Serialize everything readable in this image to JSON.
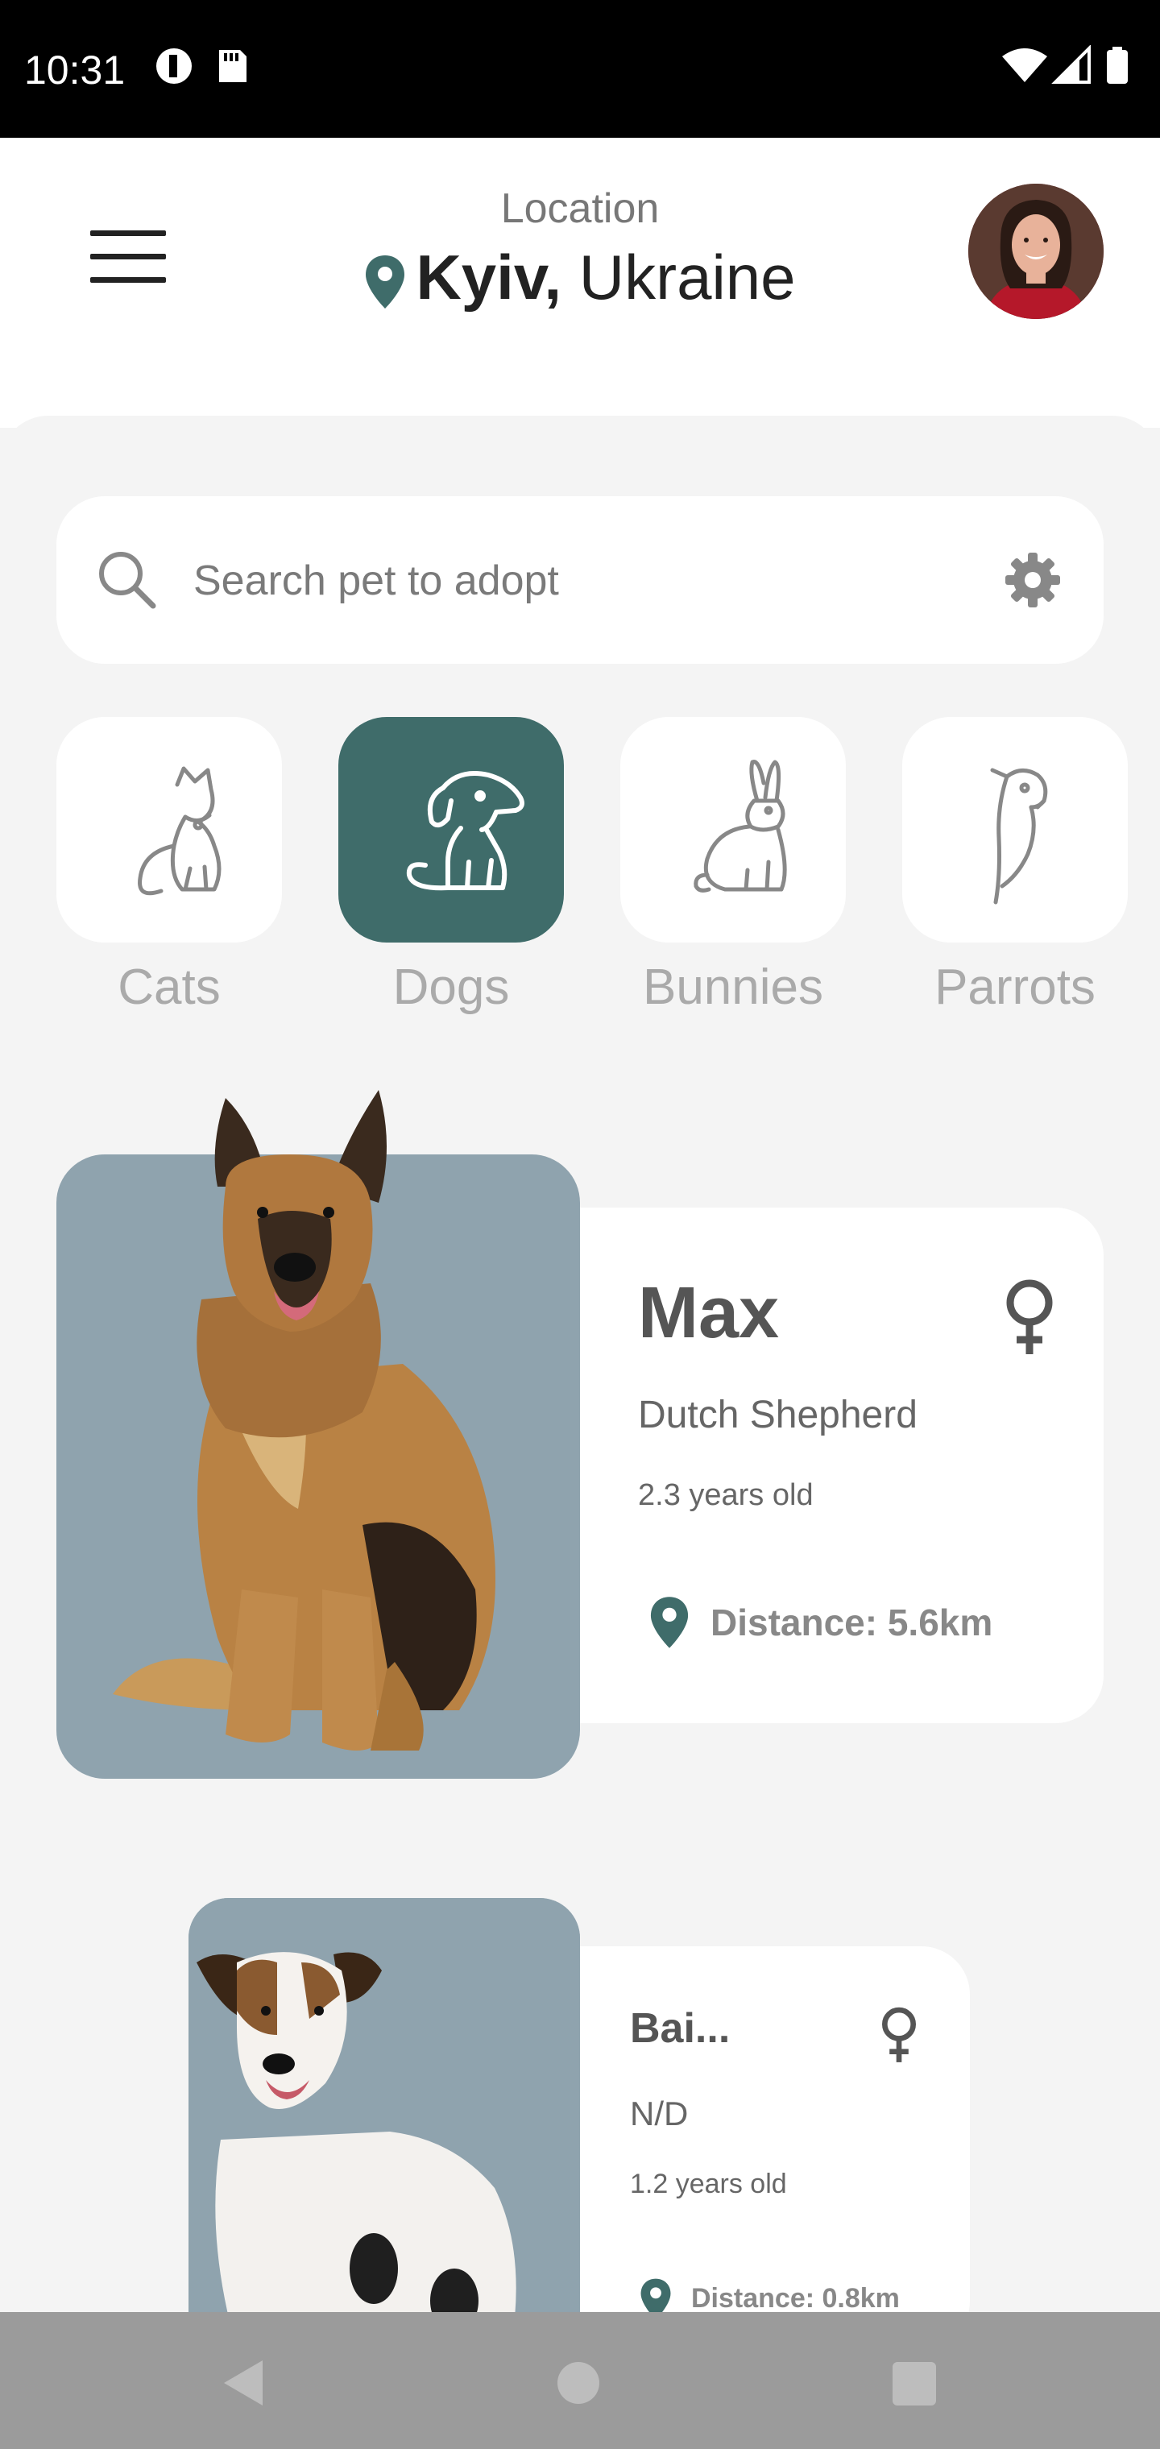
{
  "status": {
    "time": "10:31"
  },
  "header": {
    "location_label": "Location",
    "city": "Kyiv,",
    "country": "Ukraine"
  },
  "search": {
    "placeholder": "Search pet to adopt"
  },
  "categories": [
    {
      "label": "Cats",
      "icon": "cat-icon",
      "active": false
    },
    {
      "label": "Dogs",
      "icon": "dog-icon",
      "active": true
    },
    {
      "label": "Bunnies",
      "icon": "bunny-icon",
      "active": false
    },
    {
      "label": "Parrots",
      "icon": "parrot-icon",
      "active": false
    }
  ],
  "pets": [
    {
      "name": "Max",
      "breed": "Dutch Shepherd",
      "age": "2.3 years old",
      "distance": "Distance: 5.6km",
      "gender_icon": "female-icon"
    },
    {
      "name": "Bai...",
      "breed": "N/D",
      "age": "1.2 years old",
      "distance": "Distance: 0.8km",
      "gender_icon": "female-icon"
    }
  ],
  "colors": {
    "accent": "#3f6c6a",
    "photo_bg": "#8fa3ae",
    "background": "#f4f4f4"
  }
}
